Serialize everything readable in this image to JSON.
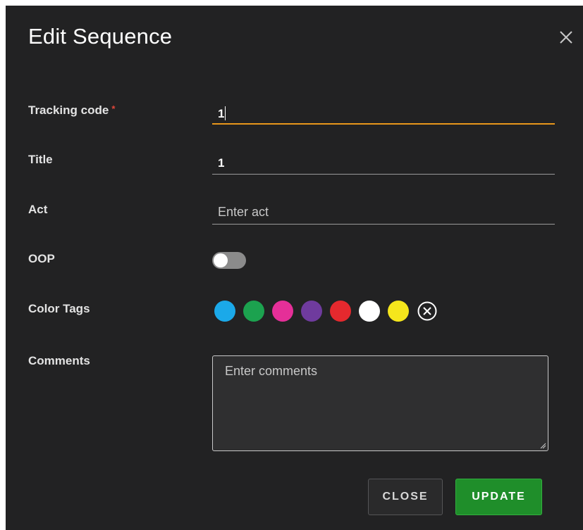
{
  "dialog": {
    "title": "Edit Sequence"
  },
  "fields": {
    "tracking_code": {
      "label": "Tracking code",
      "required_mark": "*",
      "value": "1"
    },
    "title": {
      "label": "Title",
      "value": "1"
    },
    "act": {
      "label": "Act",
      "value": "",
      "placeholder": "Enter act"
    },
    "oop": {
      "label": "OOP",
      "toggled": false
    },
    "color_tags": {
      "label": "Color Tags",
      "colors": [
        "#1ba9e9",
        "#1ca24f",
        "#e52f98",
        "#6f3b9e",
        "#e5292e",
        "#ffffff",
        "#f5e61c"
      ],
      "clear_icon": "circle-x-icon"
    },
    "comments": {
      "label": "Comments",
      "value": "",
      "placeholder": "Enter comments"
    }
  },
  "actions": {
    "close_label": "CLOSE",
    "update_label": "UPDATE"
  },
  "icons": {
    "dismiss": "close-icon"
  },
  "colors": {
    "background": "#222223",
    "focus_accent": "#e8961b",
    "required": "#e0463a",
    "primary_button": "#1f8e2a"
  }
}
